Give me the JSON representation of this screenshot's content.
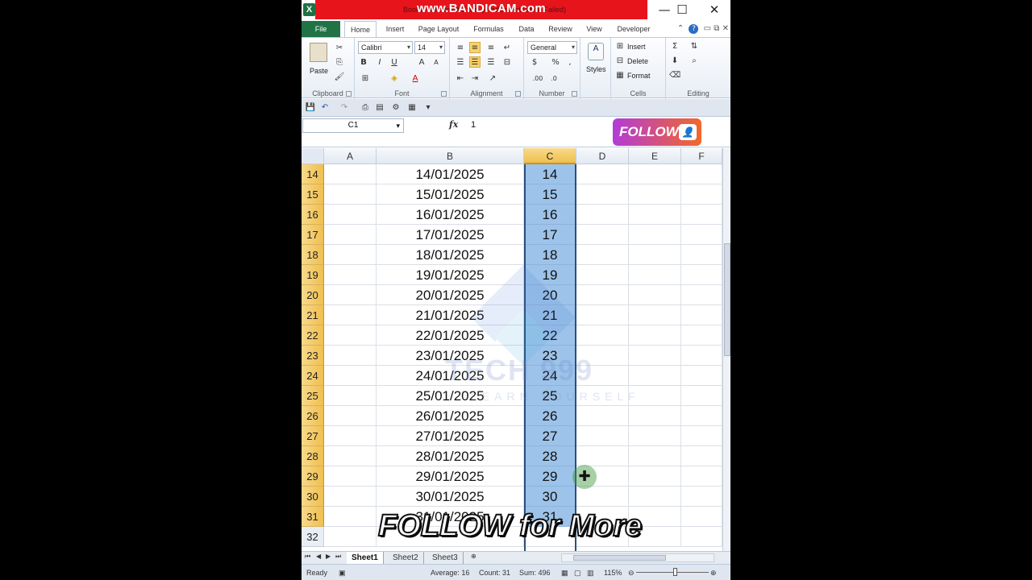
{
  "titlebar": {
    "doc_title": "Book1 - Microsoft Excel (Product Activation Failed)",
    "watermark": "www.BANDICAM.com",
    "minimize": "—",
    "maximize": "☐",
    "close": "✕"
  },
  "tabs": {
    "file": "File",
    "home": "Home",
    "insert": "Insert",
    "page_layout": "Page Layout",
    "formulas": "Formulas",
    "data": "Data",
    "review": "Review",
    "view": "View",
    "developer": "Developer"
  },
  "ribbon": {
    "clipboard": {
      "paste": "Paste",
      "label": "Clipboard"
    },
    "font": {
      "name": "Calibri",
      "size": "14",
      "label": "Font",
      "bold": "B",
      "italic": "I",
      "underline": "U",
      "grow": "A",
      "shrink": "A",
      "color_a": "A"
    },
    "alignment": {
      "label": "Alignment"
    },
    "number": {
      "format": "General",
      "currency": "$",
      "percent": "%",
      "comma": ",",
      "label": "Number"
    },
    "styles": {
      "label": "Styles"
    },
    "cells": {
      "insert": "Insert",
      "delete": "Delete",
      "format": "Format",
      "label": "Cells"
    },
    "editing": {
      "sum": "Σ",
      "label": "Editing"
    }
  },
  "formula_bar": {
    "name_box": "C1",
    "fx": "fx",
    "value": "1"
  },
  "follow_badge": "FOLLOW",
  "columns": [
    "A",
    "B",
    "C",
    "D",
    "E",
    "F"
  ],
  "rows": [
    {
      "num": "14",
      "b": "14/01/2025",
      "c": "14"
    },
    {
      "num": "15",
      "b": "15/01/2025",
      "c": "15"
    },
    {
      "num": "16",
      "b": "16/01/2025",
      "c": "16"
    },
    {
      "num": "17",
      "b": "17/01/2025",
      "c": "17"
    },
    {
      "num": "18",
      "b": "18/01/2025",
      "c": "18"
    },
    {
      "num": "19",
      "b": "19/01/2025",
      "c": "19"
    },
    {
      "num": "20",
      "b": "20/01/2025",
      "c": "20"
    },
    {
      "num": "21",
      "b": "21/01/2025",
      "c": "21"
    },
    {
      "num": "22",
      "b": "22/01/2025",
      "c": "22"
    },
    {
      "num": "23",
      "b": "23/01/2025",
      "c": "23"
    },
    {
      "num": "24",
      "b": "24/01/2025",
      "c": "24"
    },
    {
      "num": "25",
      "b": "25/01/2025",
      "c": "25"
    },
    {
      "num": "26",
      "b": "26/01/2025",
      "c": "26"
    },
    {
      "num": "27",
      "b": "27/01/2025",
      "c": "27"
    },
    {
      "num": "28",
      "b": "28/01/2025",
      "c": "28"
    },
    {
      "num": "29",
      "b": "29/01/2025",
      "c": "29"
    },
    {
      "num": "30",
      "b": "30/01/2025",
      "c": "30"
    },
    {
      "num": "31",
      "b": "31/01/2025",
      "c": "31"
    },
    {
      "num": "32",
      "b": "",
      "c": ""
    }
  ],
  "watermark_logo": {
    "text": "TECH 999",
    "sub": "LEARN YOURSELF"
  },
  "caption": "FOLLOW for More",
  "sheets": [
    "Sheet1",
    "Sheet2",
    "Sheet3"
  ],
  "statusbar": {
    "ready": "Ready",
    "average": "Average: 16",
    "count": "Count: 31",
    "sum": "Sum: 496",
    "zoom": "115%"
  },
  "colors": {
    "excel_green": "#217346",
    "selection_fill": "#9dc3ea",
    "header_highlight": "#f0bf4f",
    "record_banner": "#e8141c"
  }
}
